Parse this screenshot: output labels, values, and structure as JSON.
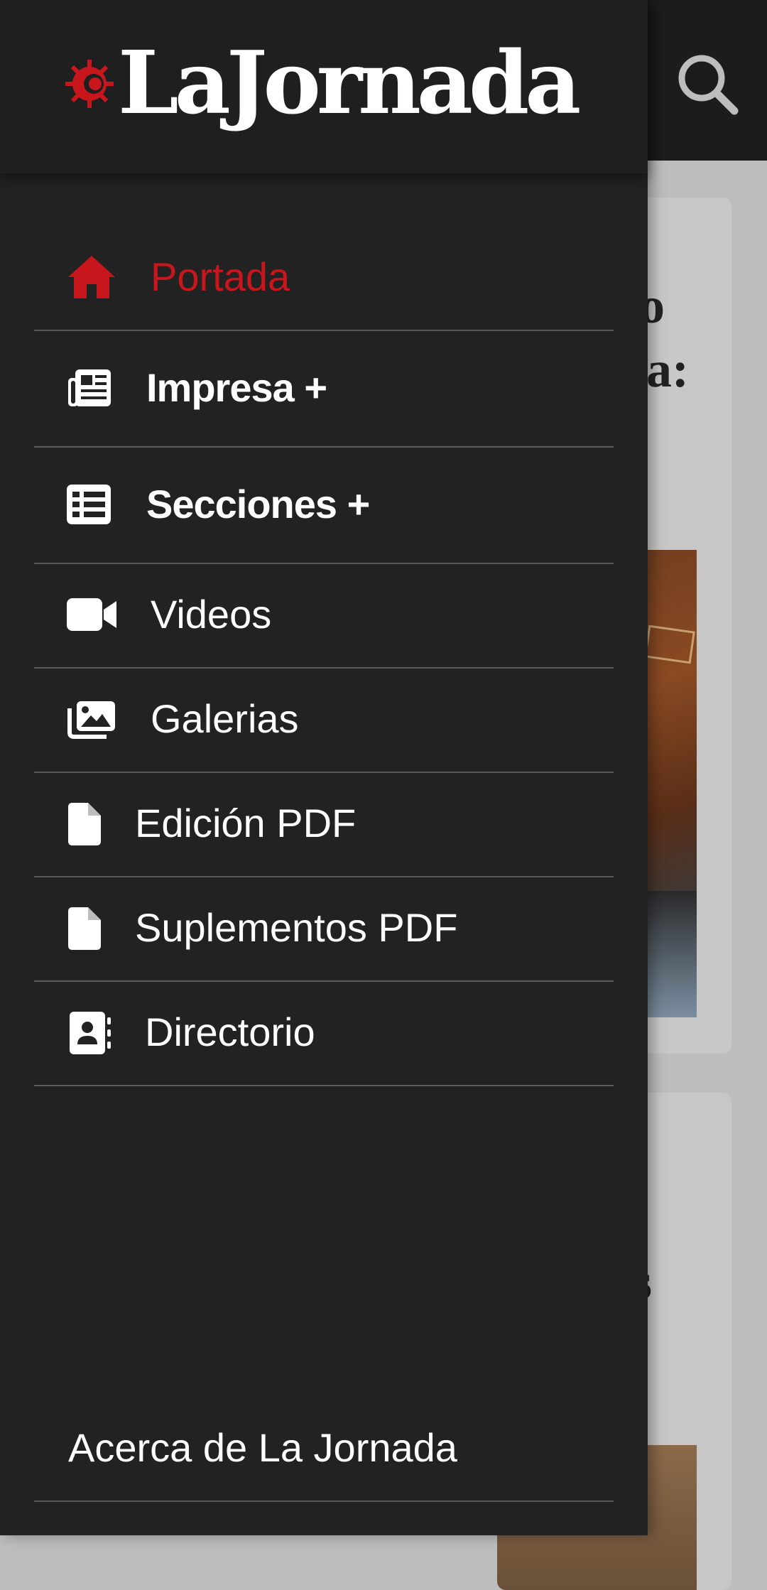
{
  "brand": {
    "name": "LaJornada",
    "accent_color": "#c8161d"
  },
  "header": {
    "search_icon": "search-icon"
  },
  "menu": {
    "items": [
      {
        "label": "Portada",
        "icon": "home-icon",
        "active": true
      },
      {
        "label": "Impresa +",
        "icon": "newspaper-icon"
      },
      {
        "label": "Secciones +",
        "icon": "list-icon"
      },
      {
        "label": "Videos",
        "icon": "video-camera-icon"
      },
      {
        "label": "Galerias",
        "icon": "images-icon"
      },
      {
        "label": "Edición PDF",
        "icon": "file-icon"
      },
      {
        "label": "Suplementos PDF",
        "icon": "file-icon"
      },
      {
        "label": "Directorio",
        "icon": "address-book-icon"
      }
    ],
    "footer_link": "Acerca de La Jornada"
  },
  "background": {
    "card1_fragments": [
      "o",
      "a:"
    ],
    "card2_fragments": [
      "s"
    ]
  }
}
